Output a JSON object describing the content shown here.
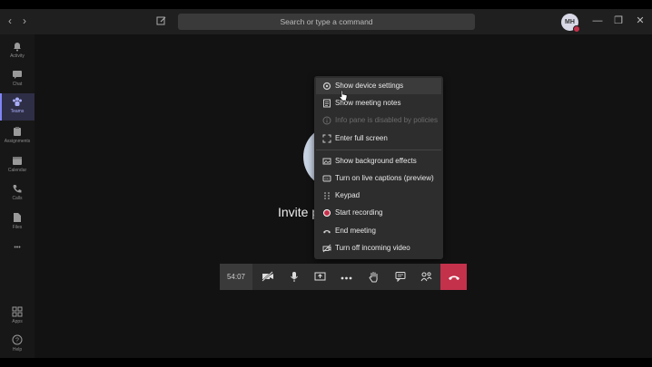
{
  "topbar": {
    "search_placeholder": "Search or type a command",
    "avatar_initials": "MH",
    "back_label": "‹",
    "forward_label": "›",
    "minimize_label": "—",
    "maximize_label": "❐",
    "close_label": "✕"
  },
  "rail": {
    "items": [
      {
        "label": "Activity",
        "icon": "bell-icon"
      },
      {
        "label": "Chat",
        "icon": "chat-icon"
      },
      {
        "label": "Teams",
        "icon": "teams-icon"
      },
      {
        "label": "Assignments",
        "icon": "assignments-icon"
      },
      {
        "label": "Calendar",
        "icon": "calendar-icon"
      },
      {
        "label": "Calls",
        "icon": "phone-icon"
      },
      {
        "label": "Files",
        "icon": "files-icon"
      },
      {
        "label": "Apps",
        "icon": "apps-icon"
      },
      {
        "label": "Help",
        "icon": "help-icon"
      }
    ],
    "more_label": "•••"
  },
  "stage": {
    "invite_text": "Invite p"
  },
  "menu": {
    "items": [
      {
        "label": "Show device settings",
        "icon": "gear-icon"
      },
      {
        "label": "Show meeting notes",
        "icon": "notes-icon"
      },
      {
        "label": "Info pane is disabled by policies",
        "icon": "info-icon"
      },
      {
        "label": "Enter full screen",
        "icon": "fullscreen-icon"
      },
      {
        "label": "Show background effects",
        "icon": "background-effects-icon"
      },
      {
        "label": "Turn on live captions (preview)",
        "icon": "captions-icon"
      },
      {
        "label": "Keypad",
        "icon": "keypad-icon"
      },
      {
        "label": "Start recording",
        "icon": "record-icon"
      },
      {
        "label": "End meeting",
        "icon": "end-meeting-icon"
      },
      {
        "label": "Turn off incoming video",
        "icon": "video-off-icon"
      }
    ]
  },
  "callbar": {
    "timer": "54:07",
    "colors": {
      "hangup": "#c4314b",
      "accent": "#7f85f5"
    }
  }
}
